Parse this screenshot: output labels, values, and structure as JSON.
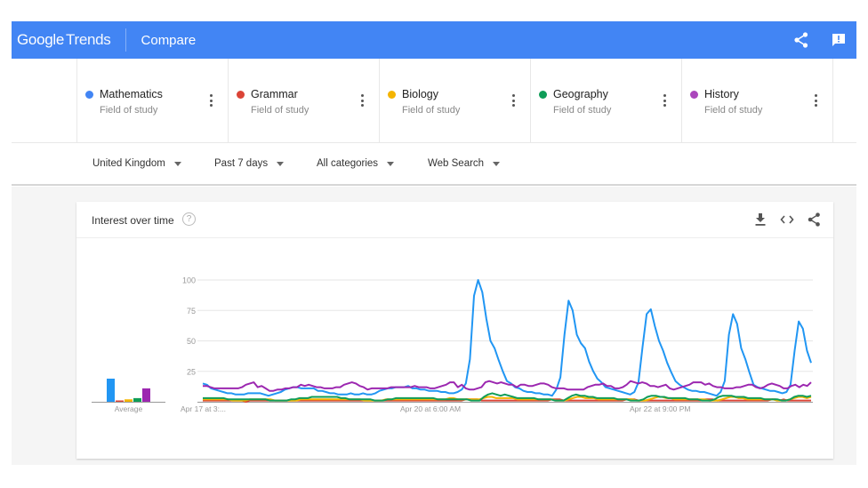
{
  "appbar": {
    "logo_google": "Google",
    "logo_trends": "Trends",
    "title": "Compare",
    "icons": [
      "share-icon",
      "feedback-icon"
    ],
    "color": "#4285f4"
  },
  "terms": [
    {
      "name": "Mathematics",
      "type": "Field of study",
      "color": "#4285f4"
    },
    {
      "name": "Grammar",
      "type": "Field of study",
      "color": "#db4437"
    },
    {
      "name": "Biology",
      "type": "Field of study",
      "color": "#f4b400"
    },
    {
      "name": "Geography",
      "type": "Field of study",
      "color": "#0f9d58"
    },
    {
      "name": "History",
      "type": "Field of study",
      "color": "#ab47bc"
    }
  ],
  "filters": {
    "region": "United Kingdom",
    "time": "Past 7 days",
    "category": "All categories",
    "search_type": "Web Search"
  },
  "card": {
    "title": "Interest over time",
    "help": "?",
    "icons": [
      "download-icon",
      "embed-icon",
      "share-icon"
    ]
  },
  "chart_data": {
    "type": "line",
    "title": "Interest over time",
    "xlabel": "",
    "ylabel": "",
    "ylim": [
      0,
      100
    ],
    "yticks": [
      25,
      50,
      75,
      100
    ],
    "x_tick_labels": [
      "Apr 17 at 3:...",
      "Apr 20 at 6:00 AM",
      "Apr 22 at 9:00 PM"
    ],
    "x_tick_positions": [
      0,
      0.4,
      0.8
    ],
    "grid": true,
    "average_label": "Average",
    "averages": [
      {
        "name": "Mathematics",
        "value": 19
      },
      {
        "name": "Grammar",
        "value": 1
      },
      {
        "name": "Biology",
        "value": 2
      },
      {
        "name": "Geography",
        "value": 3
      },
      {
        "name": "History",
        "value": 11
      }
    ],
    "series": [
      {
        "name": "Mathematics",
        "color": "#2196f3",
        "values": [
          15,
          14,
          11,
          10,
          9,
          8,
          7,
          7,
          6,
          6,
          6,
          7,
          7,
          7,
          7,
          6,
          5,
          6,
          7,
          8,
          10,
          11,
          12,
          12,
          11,
          11,
          11,
          11,
          9,
          9,
          8,
          7,
          7,
          6,
          6,
          6,
          7,
          6,
          6,
          7,
          6,
          6,
          7,
          9,
          10,
          11,
          11,
          12,
          12,
          12,
          13,
          11,
          11,
          10,
          10,
          9,
          9,
          9,
          8,
          8,
          7,
          7,
          8,
          10,
          15,
          35,
          87,
          100,
          90,
          68,
          50,
          44,
          34,
          25,
          17,
          15,
          12,
          11,
          9,
          8,
          8,
          7,
          7,
          6,
          6,
          5,
          10,
          20,
          55,
          83,
          75,
          55,
          48,
          44,
          33,
          25,
          19,
          16,
          12,
          11,
          10,
          9,
          8,
          7,
          6,
          8,
          16,
          45,
          72,
          76,
          62,
          50,
          42,
          32,
          24,
          17,
          14,
          12,
          10,
          9,
          9,
          8,
          8,
          7,
          6,
          5,
          8,
          17,
          55,
          72,
          64,
          44,
          35,
          24,
          14,
          12,
          11,
          10,
          9,
          9,
          8,
          7,
          8,
          14,
          42,
          66,
          60,
          42,
          32
        ]
      },
      {
        "name": "Grammar",
        "color": "#db4437",
        "values": [
          1,
          1,
          1,
          1,
          1,
          1,
          1,
          1,
          1,
          1,
          1,
          0,
          1,
          1,
          1,
          1,
          1,
          1,
          1,
          1,
          1,
          1,
          1,
          1,
          1,
          1,
          1,
          1,
          1,
          1,
          1,
          1,
          1,
          1,
          1,
          1,
          1,
          1,
          1,
          1,
          1,
          1,
          1,
          1,
          1,
          1,
          1,
          1,
          1,
          1,
          1,
          1,
          1,
          1,
          1,
          1,
          1,
          1,
          1,
          1,
          1,
          1,
          1,
          1,
          1,
          1,
          1,
          2,
          2,
          2,
          2,
          1,
          1,
          1,
          1,
          1,
          1,
          1,
          1,
          1,
          1,
          1,
          1,
          1,
          1,
          1,
          1,
          1,
          1,
          2,
          2,
          2,
          1,
          1,
          1,
          1,
          1,
          1,
          1,
          1,
          1,
          1,
          1,
          1,
          1,
          1,
          1,
          1,
          2,
          2,
          2,
          1,
          1,
          1,
          1,
          1,
          1,
          1,
          1,
          1,
          1,
          1,
          1,
          1,
          1,
          1,
          1,
          1,
          2,
          2,
          2,
          1,
          1,
          1,
          1,
          1,
          1,
          1,
          1,
          1,
          1,
          1,
          1,
          1,
          1,
          2,
          2,
          1,
          2,
          1,
          1,
          1,
          1,
          1,
          1,
          1
        ]
      },
      {
        "name": "Biology",
        "color": "#f4b400",
        "values": [
          2,
          2,
          2,
          2,
          2,
          2,
          2,
          1,
          1,
          1,
          1,
          2,
          2,
          2,
          2,
          2,
          2,
          1,
          1,
          1,
          1,
          1,
          1,
          2,
          2,
          2,
          2,
          2,
          2,
          2,
          2,
          2,
          2,
          2,
          2,
          2,
          2,
          2,
          1,
          1,
          1,
          1,
          1,
          2,
          2,
          2,
          2,
          2,
          2,
          2,
          2,
          2,
          2,
          2,
          2,
          2,
          2,
          2,
          3,
          3,
          2,
          2,
          2,
          2,
          2,
          2,
          3,
          4,
          4,
          3,
          3,
          3,
          3,
          3,
          2,
          2,
          2,
          2,
          2,
          2,
          2,
          2,
          2,
          1,
          1,
          1,
          2,
          3,
          4,
          4,
          3,
          3,
          3,
          2,
          2,
          2,
          2,
          2,
          2,
          2,
          2,
          2,
          1,
          1,
          1,
          2,
          3,
          4,
          4,
          3,
          3,
          2,
          2,
          2,
          2,
          2,
          2,
          2,
          2,
          1,
          1,
          1,
          2,
          3,
          4,
          4,
          3,
          3,
          2,
          2,
          2,
          2,
          2,
          2,
          2,
          1,
          1,
          1,
          2,
          3,
          4,
          4,
          3,
          4
        ]
      },
      {
        "name": "Geography",
        "color": "#0f9d58",
        "values": [
          3,
          3,
          3,
          3,
          3,
          3,
          2,
          2,
          2,
          2,
          2,
          2,
          2,
          2,
          2,
          2,
          1,
          1,
          1,
          1,
          1,
          2,
          2,
          3,
          3,
          3,
          4,
          4,
          4,
          4,
          4,
          4,
          4,
          3,
          3,
          2,
          2,
          2,
          2,
          2,
          2,
          1,
          1,
          1,
          2,
          2,
          3,
          3,
          3,
          3,
          3,
          3,
          3,
          3,
          3,
          3,
          2,
          2,
          2,
          2,
          2,
          2,
          2,
          2,
          1,
          1,
          1,
          4,
          6,
          7,
          6,
          5,
          6,
          5,
          4,
          3,
          3,
          3,
          3,
          3,
          2,
          2,
          2,
          2,
          1,
          1,
          1,
          3,
          5,
          6,
          5,
          5,
          4,
          4,
          3,
          3,
          3,
          3,
          3,
          2,
          2,
          2,
          1,
          1,
          1,
          2,
          4,
          5,
          5,
          4,
          4,
          3,
          3,
          3,
          3,
          3,
          2,
          2,
          2,
          1,
          1,
          1,
          2,
          4,
          5,
          5,
          5,
          4,
          4,
          4,
          3,
          3,
          3,
          3,
          2,
          2,
          2,
          2,
          1,
          1,
          2,
          4,
          5,
          5,
          4,
          5
        ]
      },
      {
        "name": "History",
        "color": "#9c27b0",
        "values": [
          13,
          13,
          12,
          11,
          11,
          11,
          11,
          11,
          11,
          11,
          12,
          14,
          15,
          16,
          12,
          13,
          11,
          9,
          9,
          10,
          10,
          11,
          11,
          12,
          12,
          14,
          13,
          14,
          13,
          12,
          12,
          11,
          11,
          11,
          12,
          12,
          14,
          15,
          16,
          15,
          13,
          12,
          10,
          11,
          11,
          11,
          11,
          11,
          12,
          12,
          12,
          12,
          12,
          12,
          13,
          12,
          12,
          12,
          11,
          11,
          12,
          13,
          14,
          16,
          16,
          12,
          14,
          11,
          10,
          10,
          11,
          12,
          16,
          17,
          16,
          15,
          16,
          15,
          14,
          14,
          12,
          14,
          14,
          13,
          13,
          14,
          15,
          15,
          14,
          12,
          11,
          11,
          11,
          10,
          10,
          10,
          10,
          10,
          12,
          13,
          14,
          14,
          15,
          13,
          13,
          11,
          11,
          12,
          14,
          17,
          16,
          15,
          16,
          15,
          13,
          13,
          12,
          13,
          14,
          11,
          10,
          11,
          12,
          13,
          14,
          16,
          16,
          16,
          14,
          15,
          13,
          12,
          12,
          11,
          11,
          11,
          12,
          12,
          13,
          14,
          14,
          12,
          11,
          12,
          14,
          15,
          14,
          13,
          11,
          11,
          13,
          14,
          12,
          14,
          13,
          16
        ]
      }
    ]
  }
}
